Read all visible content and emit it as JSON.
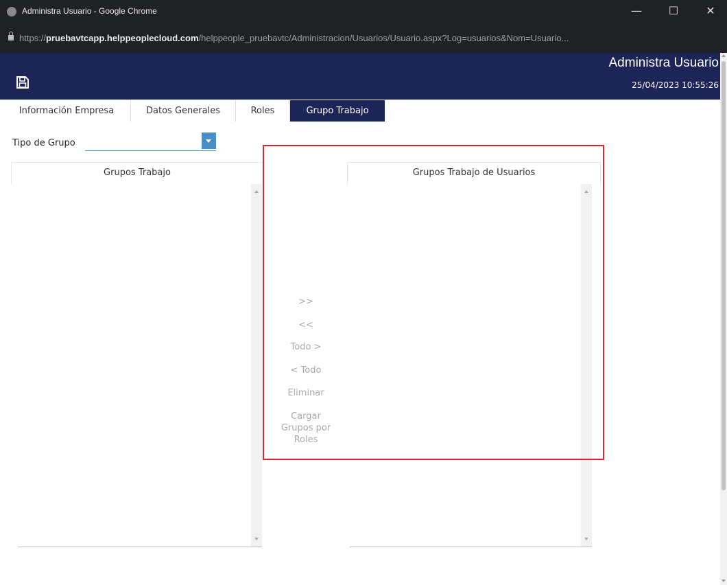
{
  "window": {
    "title": "Administra Usuario - Google Chrome",
    "minimize_glyph": "—",
    "maximize_glyph": "☐",
    "close_glyph": "✕"
  },
  "urlbar": {
    "prefix": "https://",
    "host": "pruebavtcapp.helppeoplecloud.com",
    "path": "/helppeople_pruebavtc/Administracion/Usuarios/Usuario.aspx?Log=usuarios&Nom=Usuario..."
  },
  "header": {
    "title": "Administra Usuario",
    "datetime": "25/04/2023 10:55:26",
    "save_icon": "floppy-disk-icon",
    "background_color": "#1d2558"
  },
  "tabs": [
    {
      "label": "Información Empresa",
      "active": false
    },
    {
      "label": "Datos Generales",
      "active": false
    },
    {
      "label": "Roles",
      "active": false
    },
    {
      "label": "Grupo Trabajo",
      "active": true
    }
  ],
  "filter": {
    "label": "Tipo de Grupo",
    "value": ""
  },
  "panels": {
    "left_title": "Grupos Trabajo",
    "right_title": "Grupos Trabajo de Usuarios"
  },
  "actions": {
    "add": ">>",
    "remove": "<<",
    "add_all": "Todo >",
    "remove_all": "< Todo",
    "delete": "Eliminar",
    "load_by_roles": "Cargar Grupos por Roles"
  },
  "highlight_color": "#d9232d"
}
